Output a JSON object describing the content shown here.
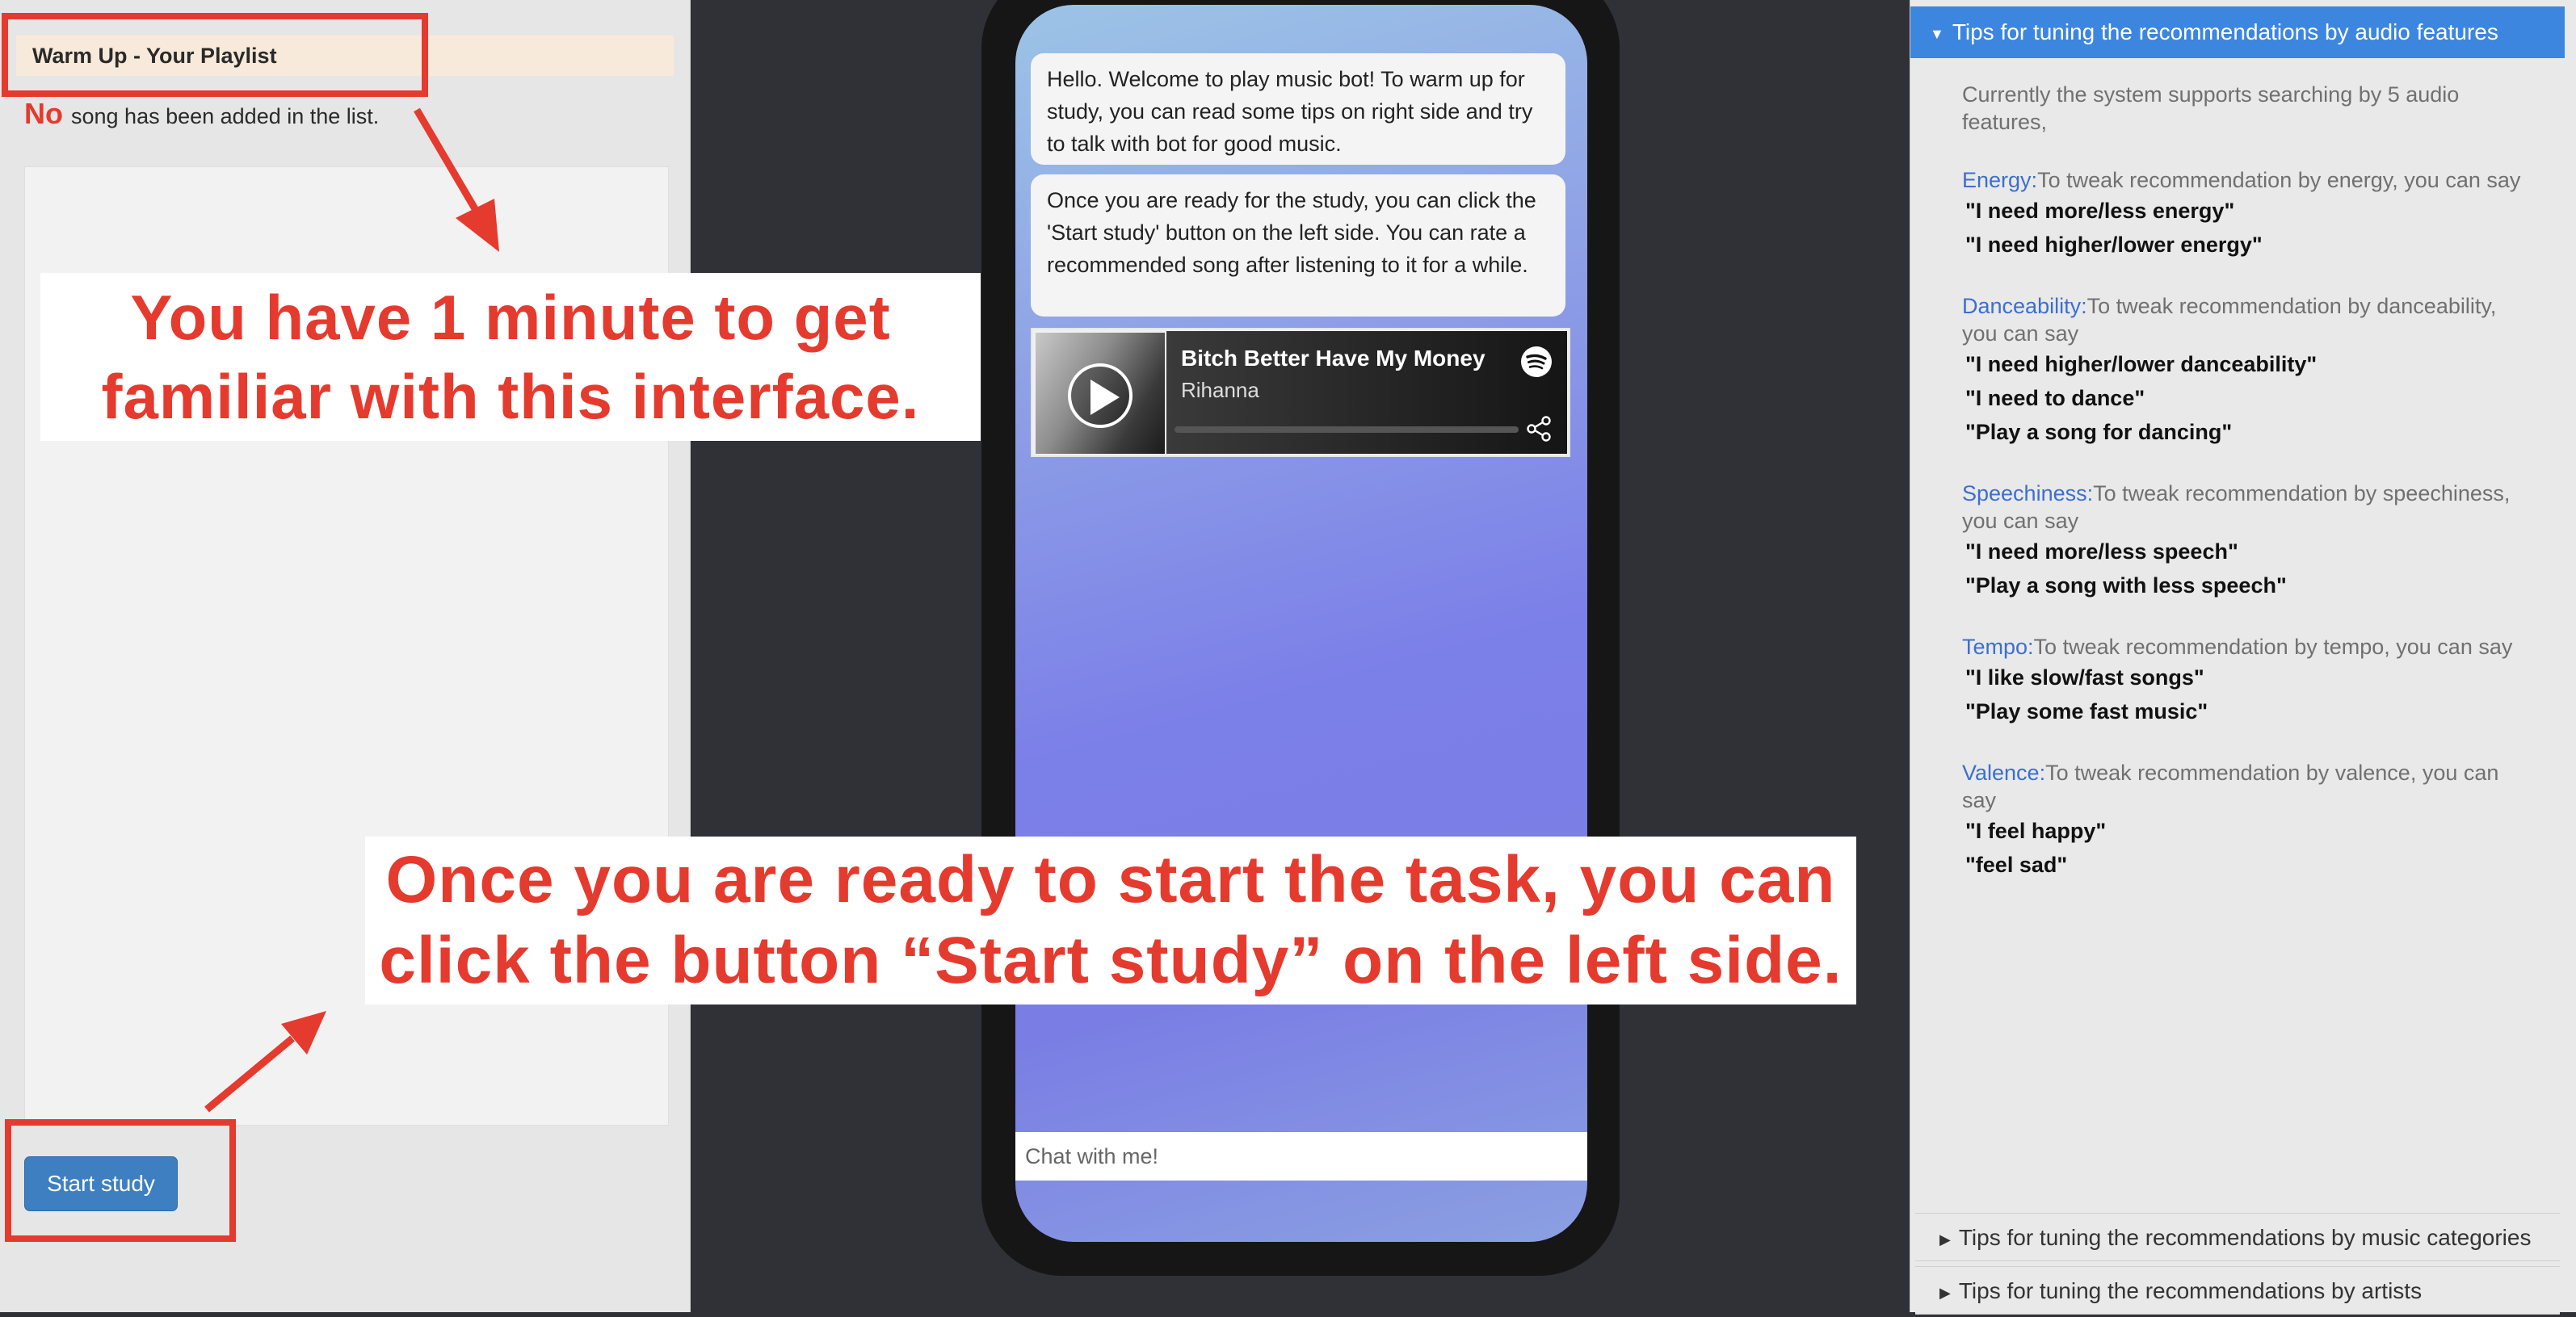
{
  "playlist": {
    "title": "Warm Up - Your Playlist",
    "status_prefix": "No",
    "status_text": "song has been added in the list.",
    "start_button": "Start study"
  },
  "chat": {
    "messages": [
      "Hello. Welcome to play music bot! To warm up for study, you can read some tips on right side and try to talk with bot for good music.",
      "Once you are ready for the study, you can click the 'Start study' button on the left side. You can rate a recommended song after listening to it for a while."
    ],
    "track": {
      "title": "Bitch Better Have My Money",
      "artist": "Rihanna",
      "progress": 0
    },
    "input_placeholder": "Chat with me!"
  },
  "tips": {
    "audio_header": "Tips for tuning the recommendations by audio features",
    "intro": "Currently the system supports searching by 5 audio features,",
    "features": [
      {
        "name": "Energy:",
        "desc": "To tweak recommendation by energy, you can say",
        "examples": [
          "\"I need more/less energy\"",
          "\"I need higher/lower energy\""
        ]
      },
      {
        "name": "Danceability:",
        "desc": "To tweak recommendation by danceability, you can say",
        "examples": [
          "\"I need higher/lower danceability\"",
          "\"I need to dance\"",
          "\"Play a song for dancing\""
        ]
      },
      {
        "name": "Speechiness:",
        "desc": "To tweak recommendation by speechiness, you can say",
        "examples": [
          "\"I need more/less speech\"",
          "\"Play a song with less speech\""
        ]
      },
      {
        "name": "Tempo:",
        "desc": "To tweak recommendation by tempo, you can say",
        "examples": [
          "\"I like slow/fast songs\"",
          "\"Play some fast music\""
        ]
      },
      {
        "name": "Valence:",
        "desc": "To tweak recommendation by valence, you can say",
        "examples": [
          "\"I feel happy\"",
          "\"feel sad\""
        ]
      }
    ],
    "categories_header": "Tips for tuning the recommendations by music categories",
    "artists_header": "Tips for tuning the recommendations by artists"
  },
  "annotations": {
    "callout_minute": [
      "You have 1 minute to get",
      "familiar with this interface."
    ],
    "callout_start": [
      "Once you are ready to start the task, you can",
      "click the button “Start study” on the left side."
    ]
  },
  "colors": {
    "accent_blue": "#3c86e0",
    "annotation_red": "#e53a2e",
    "button_blue": "#3d7fc0"
  },
  "icons": [
    "play-icon",
    "spotify-icon",
    "share-icon",
    "caret-down-icon",
    "caret-right-icon"
  ]
}
